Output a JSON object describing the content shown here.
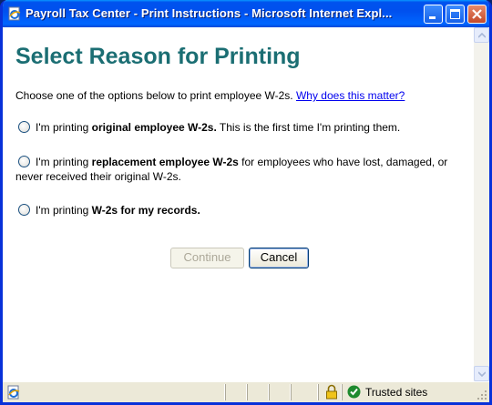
{
  "window": {
    "title": "Payroll Tax Center - Print Instructions - Microsoft Internet Expl...",
    "icon": "ie-page-icon",
    "controls": [
      "minimize",
      "maximize",
      "close"
    ]
  },
  "page": {
    "heading": "Select Reason for Printing",
    "intro": "Choose one of the options below to print employee W-2s.",
    "help_link": "Why does this matter?",
    "options": [
      {
        "pre": "I'm printing ",
        "bold": "original employee W-2s.",
        "post": " This is the first time I'm printing them.",
        "selected": false
      },
      {
        "pre": "I'm printing ",
        "bold": "replacement employee W-2s",
        "post": " for employees who have lost, damaged, or never received their original W-2s.",
        "selected": false
      },
      {
        "pre": "I'm printing ",
        "bold": "W-2s for my records.",
        "post": "",
        "selected": false
      }
    ],
    "buttons": {
      "continue": "Continue",
      "cancel": "Cancel"
    }
  },
  "statusbar": {
    "zone": "Trusted sites"
  },
  "colors": {
    "heading": "#1b6e73",
    "link": "#0000ee",
    "titlebar": "#0053ee"
  }
}
